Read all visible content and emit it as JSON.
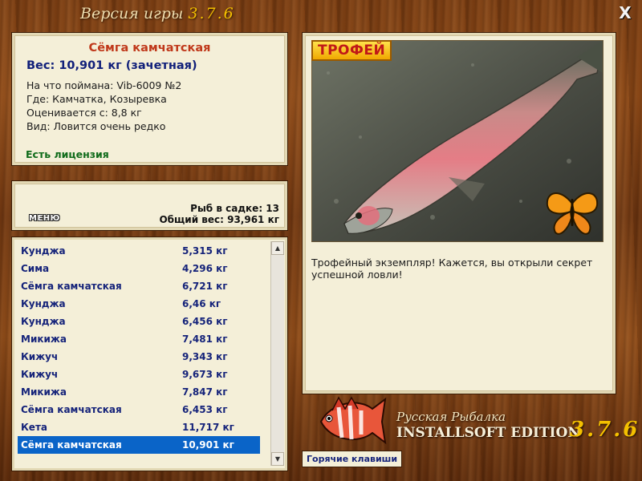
{
  "window": {
    "title_prefix": "Версия игры",
    "title_version": "3.7.6",
    "close_glyph": "X"
  },
  "fish_info": {
    "name": "Сёмга камчатская",
    "weight": "Вес: 10,901 кг (зачетная)",
    "bait": "На что поймана: Vib-6009 №2",
    "place": "Где: Камчатка, Козыревка",
    "threshold": "Оценивается с: 8,8 кг",
    "rarity": "Вид: Ловится очень редко",
    "license": "Есть лицензия"
  },
  "stats": {
    "menu_label": "МЕНЮ",
    "fish_in_keepnet": "Рыб в садке: 13",
    "total_weight": "Общий вес: 93,961 кг"
  },
  "catch_list": [
    {
      "name": "Кунджа",
      "weight": "5,315 кг"
    },
    {
      "name": "Сима",
      "weight": "4,296 кг"
    },
    {
      "name": "Сёмга камчатская",
      "weight": "6,721 кг"
    },
    {
      "name": "Кунджа",
      "weight": "6,46 кг"
    },
    {
      "name": "Кунджа",
      "weight": "6,456 кг"
    },
    {
      "name": "Микижа",
      "weight": "7,481 кг"
    },
    {
      "name": "Кижуч",
      "weight": "9,343 кг"
    },
    {
      "name": "Кижуч",
      "weight": "9,673 кг"
    },
    {
      "name": "Микижа",
      "weight": "7,847 кг"
    },
    {
      "name": "Сёмга камчатская",
      "weight": "6,453 кг"
    },
    {
      "name": "Кета",
      "weight": "11,717 кг"
    },
    {
      "name": "Сёмга камчатская",
      "weight": "10,901 кг",
      "selected": true
    }
  ],
  "photo": {
    "badge": "ТРОФЕЙ",
    "description": "Трофейный экземпляр! Кажется, вы открыли секрет успешной ловли!"
  },
  "logo": {
    "subtitle": "Русская Рыбалка",
    "edition": "INSTALLSOFT EDITION",
    "version": "3.7.6"
  },
  "hotkeys_label": "Горячие клавиши",
  "colors": {
    "fish_name": "#c0391b",
    "weight_text": "#11207a",
    "license_text": "#0f6b1a",
    "list_text": "#15237a",
    "selection": "#0a64c8",
    "version_accent": "#f4c000"
  }
}
